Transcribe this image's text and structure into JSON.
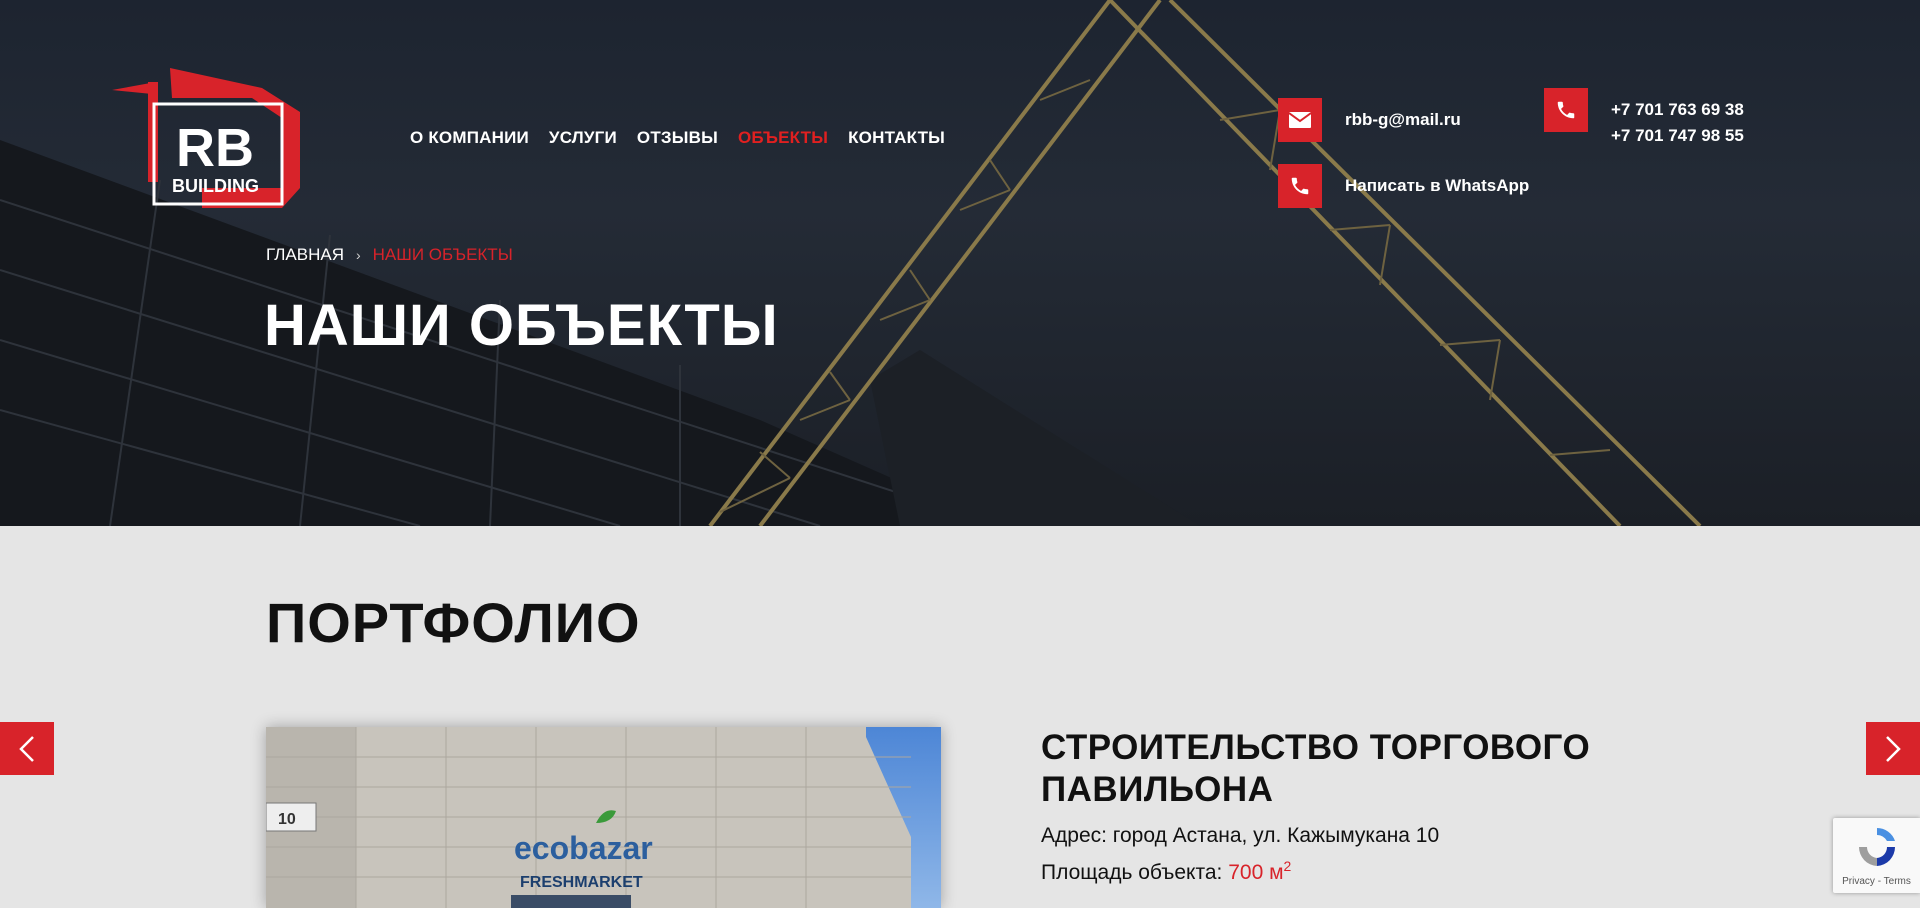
{
  "brand": {
    "line1": "RB",
    "line2": "BUILDING"
  },
  "nav": {
    "items": [
      {
        "label": "О КОМПАНИИ",
        "active": false
      },
      {
        "label": "УСЛУГИ",
        "active": false
      },
      {
        "label": "ОТЗЫВЫ",
        "active": false
      },
      {
        "label": "ОБЪЕКТЫ",
        "active": true
      },
      {
        "label": "КОНТАКТЫ",
        "active": false
      }
    ]
  },
  "contacts": {
    "email": "rbb-g@mail.ru",
    "whatsapp": "Написать в WhatsApp",
    "phone1": "+7 701 763 69 38",
    "phone2": "+7 701 747 98 55"
  },
  "breadcrumb": {
    "home": "ГЛАВНАЯ",
    "separator": "›",
    "current": "НАШИ ОБЪЕКТЫ"
  },
  "hero": {
    "title": "НАШИ ОБЪЕКТЫ"
  },
  "portfolio": {
    "title": "ПОРТФОЛИО",
    "project": {
      "title": "СТРОИТЕЛЬСТВО ТОРГОВОГО ПАВИЛЬОНА",
      "address_label": "Адрес:",
      "address_value": "город Астана, ул. Кажымукана 10",
      "area_label": "Площадь объекта:",
      "area_value": "700 м",
      "area_sup": "2"
    },
    "photo": {
      "sign_number": "10",
      "store_name": "ecobazar",
      "store_sub": "FRESHMARKET"
    }
  },
  "recaptcha": {
    "label": "Privacy - Terms"
  },
  "colors": {
    "accent": "#d8232a",
    "page_bg": "#e5e5e5",
    "hero_bg": "#1d2430"
  }
}
